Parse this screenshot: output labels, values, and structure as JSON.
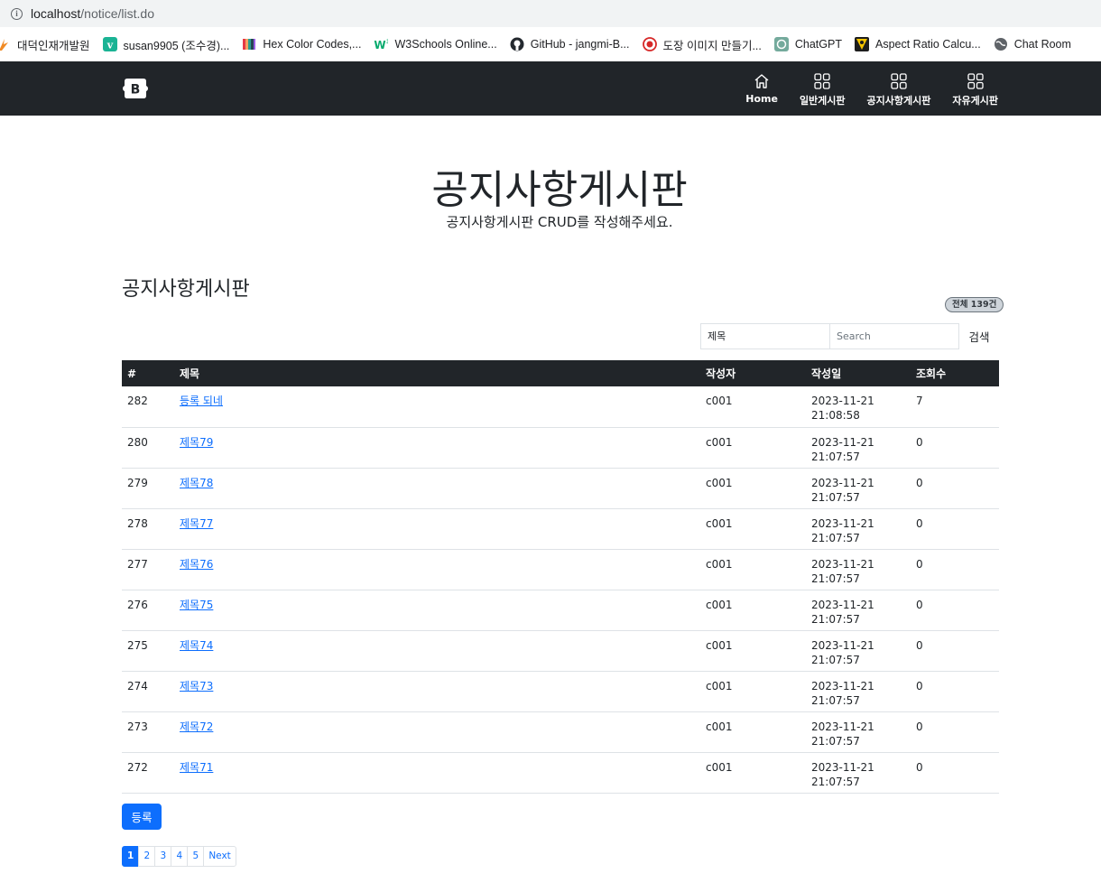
{
  "browser": {
    "url_host": "localhost",
    "url_path": "/notice/list.do",
    "bookmarks": [
      {
        "label": "대덕인재개발원",
        "icon": "flame-icon",
        "color": "#f08a24"
      },
      {
        "label": "susan9905 (조수경)...",
        "icon": "v-logo-icon",
        "color": "#1ab394"
      },
      {
        "label": "Hex Color Codes,...",
        "icon": "color-bars-icon",
        "color": "#e63946"
      },
      {
        "label": "W3Schools Online...",
        "icon": "w3-icon",
        "color": "#04aa6d"
      },
      {
        "label": "GitHub - jangmi-B...",
        "icon": "github-icon",
        "color": "#24292f"
      },
      {
        "label": "도장 이미지 만들기...",
        "icon": "stamp-icon",
        "color": "#d62828"
      },
      {
        "label": "ChatGPT",
        "icon": "chatgpt-icon",
        "color": "#74aa9c"
      },
      {
        "label": "Aspect Ratio Calcu...",
        "icon": "aspect-icon",
        "color": "#f5c400"
      },
      {
        "label": "Chat Room",
        "icon": "globe-icon",
        "color": "#5f6368"
      }
    ]
  },
  "navbar": {
    "brand": "B",
    "items": [
      {
        "label": "Home",
        "icon": "home-icon"
      },
      {
        "label": "일반게시판",
        "icon": "grid-icon"
      },
      {
        "label": "공지사항게시판",
        "icon": "grid-icon"
      },
      {
        "label": "자유게시판",
        "icon": "grid-icon"
      }
    ]
  },
  "header": {
    "title": "공지사항게시판",
    "subtitle": "공지사항게시판 CRUD를 작성해주세요."
  },
  "board": {
    "title": "공지사항게시판",
    "total_badge": "전체 139건",
    "search": {
      "select_value": "제목",
      "placeholder": "Search",
      "button_label": "검색"
    },
    "columns": [
      "#",
      "제목",
      "작성자",
      "작성일",
      "조회수"
    ],
    "rows": [
      {
        "no": "282",
        "title": "등록 되네",
        "writer": "c001",
        "date": "2023-11-21",
        "time": "21:08:58",
        "views": "7"
      },
      {
        "no": "280",
        "title": "제목79",
        "writer": "c001",
        "date": "2023-11-21",
        "time": "21:07:57",
        "views": "0"
      },
      {
        "no": "279",
        "title": "제목78",
        "writer": "c001",
        "date": "2023-11-21",
        "time": "21:07:57",
        "views": "0"
      },
      {
        "no": "278",
        "title": "제목77",
        "writer": "c001",
        "date": "2023-11-21",
        "time": "21:07:57",
        "views": "0"
      },
      {
        "no": "277",
        "title": "제목76",
        "writer": "c001",
        "date": "2023-11-21",
        "time": "21:07:57",
        "views": "0"
      },
      {
        "no": "276",
        "title": "제목75",
        "writer": "c001",
        "date": "2023-11-21",
        "time": "21:07:57",
        "views": "0"
      },
      {
        "no": "275",
        "title": "제목74",
        "writer": "c001",
        "date": "2023-11-21",
        "time": "21:07:57",
        "views": "0"
      },
      {
        "no": "274",
        "title": "제목73",
        "writer": "c001",
        "date": "2023-11-21",
        "time": "21:07:57",
        "views": "0"
      },
      {
        "no": "273",
        "title": "제목72",
        "writer": "c001",
        "date": "2023-11-21",
        "time": "21:07:57",
        "views": "0"
      },
      {
        "no": "272",
        "title": "제목71",
        "writer": "c001",
        "date": "2023-11-21",
        "time": "21:07:57",
        "views": "0"
      }
    ],
    "register_label": "등록",
    "pagination": {
      "pages": [
        "1",
        "2",
        "3",
        "4",
        "5"
      ],
      "active": "1",
      "next_label": "Next"
    }
  }
}
